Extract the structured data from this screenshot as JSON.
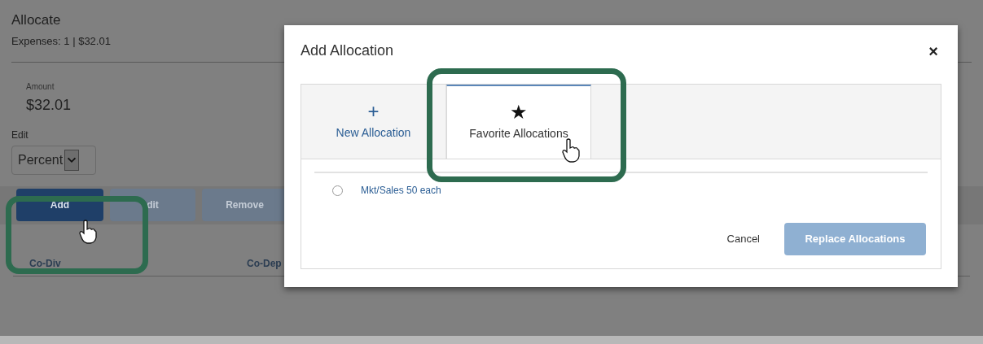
{
  "page": {
    "title": "Allocate",
    "summary": "Expenses: 1 | $32.01",
    "amount_label": "Amount",
    "amount": "$32.01",
    "edit_label": "Edit",
    "edit_mode": "Percent"
  },
  "toolbar": [
    {
      "label": "Add",
      "disabled": false
    },
    {
      "label": "dit",
      "disabled": true
    },
    {
      "label": "Remove",
      "disabled": true
    }
  ],
  "table": {
    "columns": [
      "Co-Div",
      "Co-Dep"
    ]
  },
  "dialog": {
    "title": "Add Allocation",
    "close": "×",
    "tabs": [
      {
        "icon": "+",
        "label": "New Allocation",
        "selected": false
      },
      {
        "icon": "★",
        "label": "Favorite Allocations",
        "selected": true
      }
    ],
    "favorites": [
      {
        "label": "Mkt/Sales 50 each",
        "selected": false
      }
    ],
    "buttons": [
      {
        "label": "Cancel",
        "kind": "link",
        "disabled": false
      },
      {
        "label": "Replace Allocations",
        "kind": "primary",
        "disabled": true
      }
    ]
  }
}
